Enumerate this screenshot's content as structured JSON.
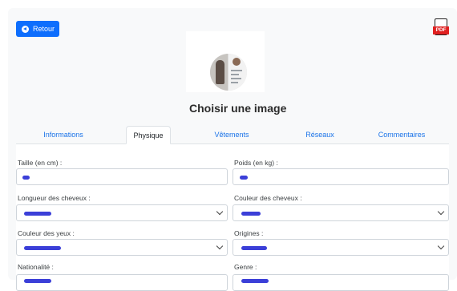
{
  "header": {
    "back_label": "Retour"
  },
  "profile": {
    "choose_image_label": "Choisir une image"
  },
  "tabs": [
    {
      "label": "Informations"
    },
    {
      "label": "Physique"
    },
    {
      "label": "Vêtements"
    },
    {
      "label": "Réseaux"
    },
    {
      "label": "Commentaires"
    }
  ],
  "active_tab": "Physique",
  "form": {
    "height_label": "Taille (en cm) :",
    "weight_label": "Poids (en kg) :",
    "hair_length_label": "Longueur des cheveux :",
    "hair_color_label": "Couleur des cheveux :",
    "eye_color_label": "Couleur des yeux :",
    "origins_label": "Origines :",
    "nationality_label": "Nationalité :",
    "gender_label": "Genre :"
  },
  "colors": {
    "primary": "#0d6efd",
    "tab_link": "#1a73e8",
    "redaction": "#3b3fd8",
    "pdf_red": "#e02020"
  },
  "icons": {
    "back": "arrow-left-circle-icon",
    "pdf": "pdf-file-icon",
    "select": "chevron-down-icon"
  }
}
